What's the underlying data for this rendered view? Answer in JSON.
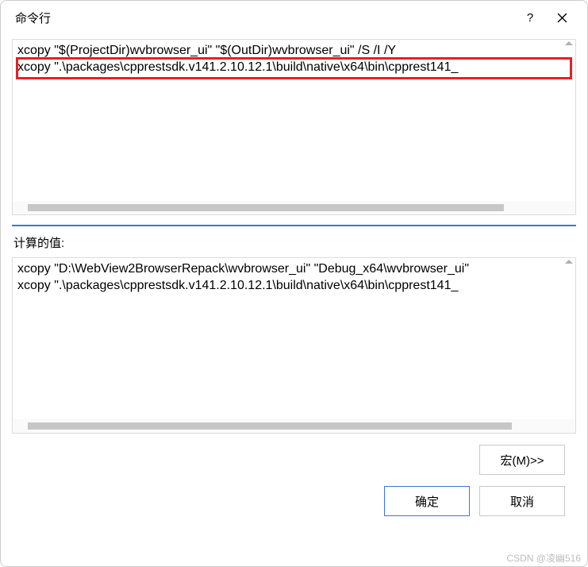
{
  "titlebar": {
    "title": "命令行",
    "help": "?",
    "close": "x"
  },
  "editor": {
    "line1": "xcopy \"$(ProjectDir)wvbrowser_ui\" \"$(OutDir)wvbrowser_ui\" /S /I /Y",
    "line2": "xcopy \".\\packages\\cpprestsdk.v141.2.10.12.1\\build\\native\\x64\\bin\\cpprest141_"
  },
  "evaluated_label": "计算的值:",
  "evaluated": {
    "line1": "xcopy \"D:\\WebView2BrowserRepack\\wvbrowser_ui\" \"Debug_x64\\wvbrowser_ui\"",
    "line2": "xcopy \".\\packages\\cpprestsdk.v141.2.10.12.1\\build\\native\\x64\\bin\\cpprest141_"
  },
  "buttons": {
    "macros": "宏(M)>>",
    "ok": "确定",
    "cancel": "取消"
  },
  "watermark": "CSDN @凌幽516"
}
